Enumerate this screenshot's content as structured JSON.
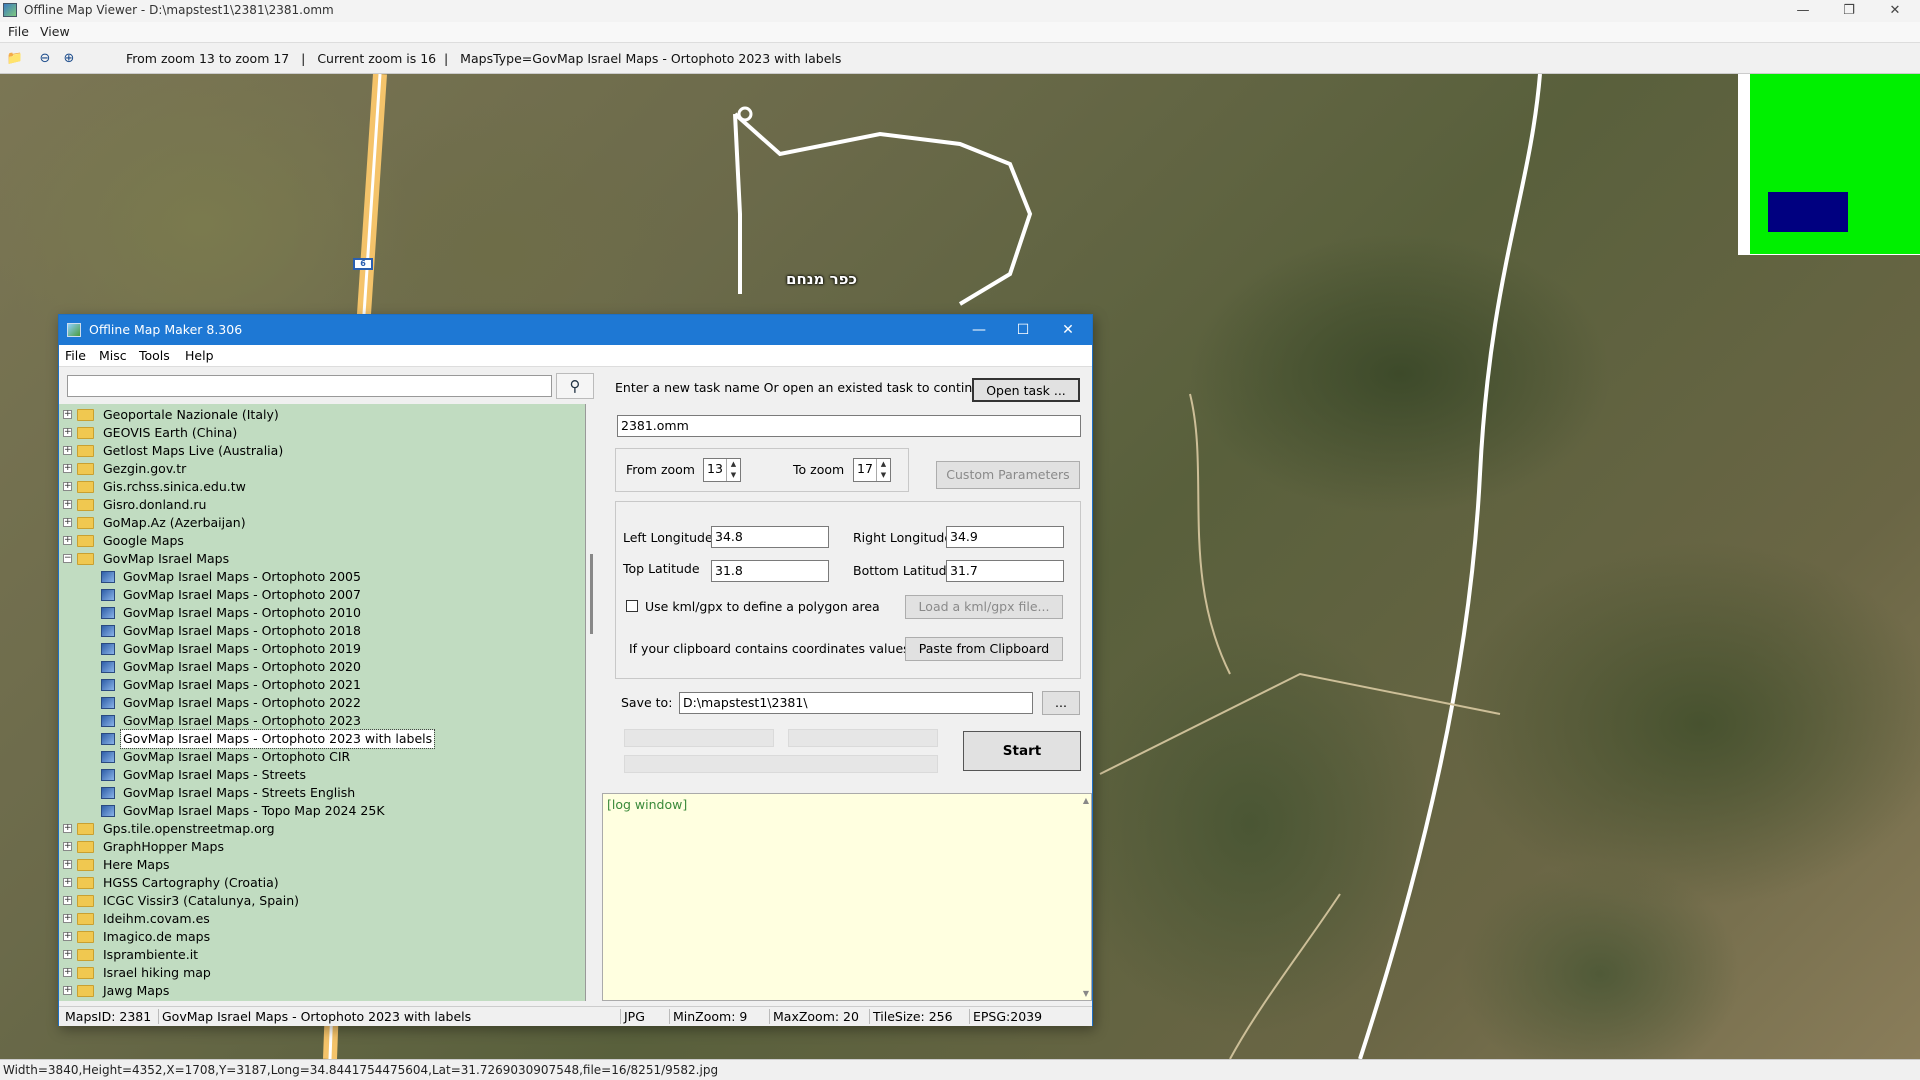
{
  "window": {
    "title": "Offline Map Viewer - D:\\mapstest1\\2381\\2381.omm"
  },
  "menu": [
    "File",
    "View"
  ],
  "toolbar": {
    "status": "From zoom 13 to zoom 17   |   Current zoom is 16  |   MapsType=GovMap Israel Maps - Ortophoto 2023 with labels"
  },
  "map": {
    "label": "כפר מנחם",
    "road_marker": "6"
  },
  "statusbar": "Width=3840,Height=4352,X=1708,Y=3187,Long=34.8441754475604,Lat=31.7269030907548,file=16/8251/9582.jpg",
  "dialog": {
    "title": "Offline Map Maker 8.306",
    "menu": [
      "File",
      "Misc",
      "Tools",
      "Help"
    ],
    "search_value": "",
    "tree": [
      {
        "label": "Geoportale Nazionale (Italy)",
        "level": 0,
        "expand": "+"
      },
      {
        "label": "GEOVIS Earth (China)",
        "level": 0,
        "expand": "+"
      },
      {
        "label": "Getlost Maps Live (Australia)",
        "level": 0,
        "expand": "+"
      },
      {
        "label": "Gezgin.gov.tr",
        "level": 0,
        "expand": "+"
      },
      {
        "label": "Gis.rchss.sinica.edu.tw",
        "level": 0,
        "expand": "+"
      },
      {
        "label": "Gisro.donland.ru",
        "level": 0,
        "expand": "+"
      },
      {
        "label": "GoMap.Az (Azerbaijan)",
        "level": 0,
        "expand": "+"
      },
      {
        "label": "Google Maps",
        "level": 0,
        "expand": "+"
      },
      {
        "label": "GovMap Israel Maps",
        "level": 0,
        "expand": "−"
      },
      {
        "label": "GovMap Israel Maps - Ortophoto 2005",
        "level": 1
      },
      {
        "label": "GovMap Israel Maps - Ortophoto 2007",
        "level": 1
      },
      {
        "label": "GovMap Israel Maps - Ortophoto 2010",
        "level": 1
      },
      {
        "label": "GovMap Israel Maps - Ortophoto 2018",
        "level": 1
      },
      {
        "label": "GovMap Israel Maps - Ortophoto 2019",
        "level": 1
      },
      {
        "label": "GovMap Israel Maps - Ortophoto 2020",
        "level": 1
      },
      {
        "label": "GovMap Israel Maps - Ortophoto 2021",
        "level": 1
      },
      {
        "label": "GovMap Israel Maps - Ortophoto 2022",
        "level": 1
      },
      {
        "label": "GovMap Israel Maps - Ortophoto 2023",
        "level": 1
      },
      {
        "label": "GovMap Israel Maps - Ortophoto 2023 with labels",
        "level": 1,
        "selected": true
      },
      {
        "label": "GovMap Israel Maps - Ortophoto CIR",
        "level": 1
      },
      {
        "label": "GovMap Israel Maps - Streets",
        "level": 1
      },
      {
        "label": "GovMap Israel Maps - Streets English",
        "level": 1
      },
      {
        "label": "GovMap Israel Maps - Topo Map 2024 25K",
        "level": 1
      },
      {
        "label": "Gps.tile.openstreetmap.org",
        "level": 0,
        "expand": "+"
      },
      {
        "label": "GraphHopper Maps",
        "level": 0,
        "expand": "+"
      },
      {
        "label": "Here Maps",
        "level": 0,
        "expand": "+"
      },
      {
        "label": "HGSS Cartography (Croatia)",
        "level": 0,
        "expand": "+"
      },
      {
        "label": "ICGC Vissir3 (Catalunya, Spain)",
        "level": 0,
        "expand": "+"
      },
      {
        "label": "Ideihm.covam.es",
        "level": 0,
        "expand": "+"
      },
      {
        "label": "Imagico.de maps",
        "level": 0,
        "expand": "+"
      },
      {
        "label": "Isprambiente.it",
        "level": 0,
        "expand": "+"
      },
      {
        "label": "Israel hiking map",
        "level": 0,
        "expand": "+"
      },
      {
        "label": "Jawg Maps",
        "level": 0,
        "expand": "+"
      }
    ],
    "task_prompt": "Enter a new task name Or open an existed task to continue:",
    "open_task": "Open task ...",
    "task_name": "2381.omm",
    "from_zoom_label": "From zoom",
    "from_zoom": "13",
    "to_zoom_label": "To zoom",
    "to_zoom": "17",
    "custom_params": "Custom Parameters",
    "left_lon_label": "Left Longitude",
    "left_lon": "34.8",
    "right_lon_label": "Right Longitude",
    "right_lon": "34.9",
    "top_lat_label": "Top Latitude",
    "top_lat": "31.8",
    "bottom_lat_label": "Bottom Latitude",
    "bottom_lat": "31.7",
    "kml_label": "Use kml/gpx to define a polygon area",
    "kml_btn": "Load a kml/gpx file...",
    "clipboard_label": "If your clipboard contains coordinates values:",
    "clipboard_btn": "Paste from Clipboard",
    "save_label": "Save to:",
    "save_path": "D:\\mapstest1\\2381\\",
    "browse": "...",
    "start": "Start",
    "log": "[log window]",
    "status": {
      "mapsid": "MapsID: 2381",
      "maptype": "GovMap Israel Maps - Ortophoto 2023 with labels",
      "format": "JPG",
      "minzoom": "MinZoom: 9",
      "maxzoom": "MaxZoom: 20",
      "tilesize": "TileSize: 256",
      "epsg": "EPSG:2039"
    }
  },
  "colors": {
    "tree_bg": "#c1dcc1",
    "dialog_title": "#1e78d4",
    "minimap_green": "#00f000",
    "minimap_blue": "#000080",
    "log_bg": "#ffffe0"
  }
}
